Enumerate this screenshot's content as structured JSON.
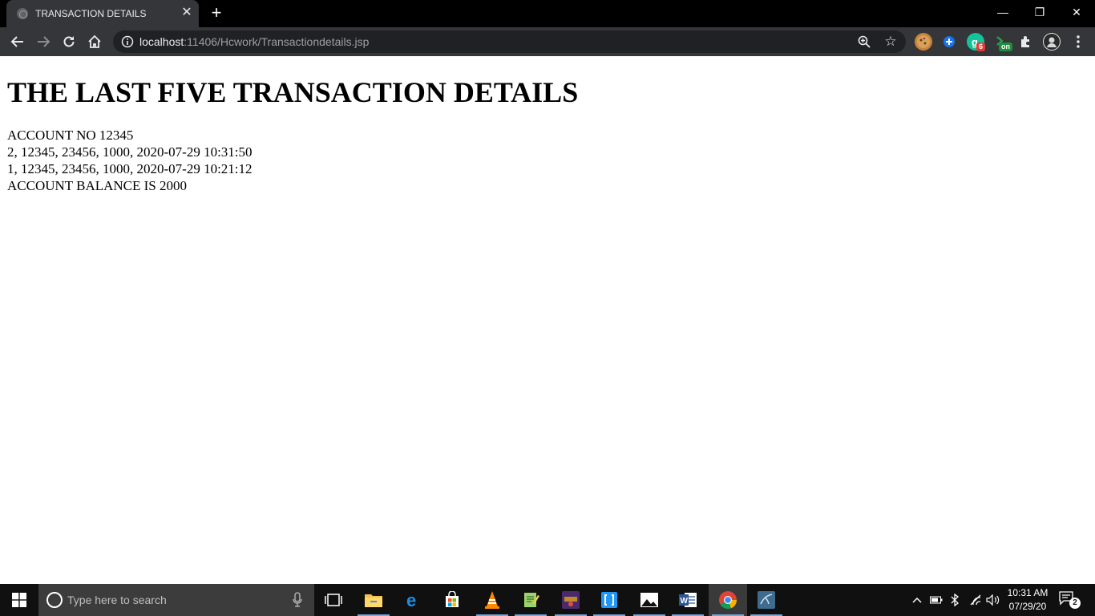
{
  "browser": {
    "tab": {
      "title": "TRANSACTION DETAILS",
      "favicon": "globe-icon",
      "close_glyph": "✕"
    },
    "new_tab_glyph": "+",
    "window_controls": {
      "minimize": "—",
      "restore": "❐",
      "close": "✕"
    },
    "toolbar": {
      "url_host": "localhost",
      "url_rest": ":11406/Hcwork/Transactiondetails.jsp",
      "star_glyph": "☆",
      "extension_badges": {
        "grammarly": "6",
        "toggle": "on"
      }
    }
  },
  "page": {
    "heading": "THE LAST FIVE TRANSACTION DETAILS",
    "lines": [
      "ACCOUNT NO 12345",
      "2, 12345, 23456, 1000, 2020-07-29 10:31:50",
      "1, 12345, 23456, 1000, 2020-07-29 10:21:12",
      "ACCOUNT BALANCE IS 2000"
    ]
  },
  "taskbar": {
    "search_placeholder": "Type here to search",
    "time": "10:31 AM",
    "date": "07/29/20",
    "notification_count": "2"
  },
  "colors": {
    "tabstrip": "#000000",
    "toolbar": "#35363a",
    "omnibox": "#202124",
    "taskbar": "#101010"
  }
}
